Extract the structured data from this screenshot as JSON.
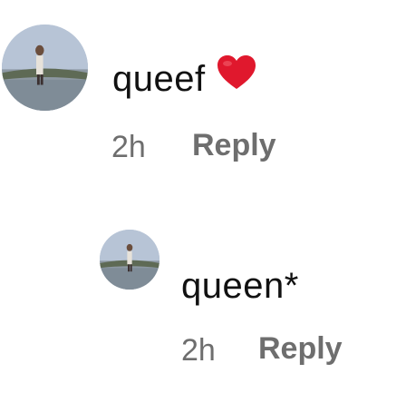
{
  "comments": [
    {
      "text": "queef",
      "emoji": "red-heart",
      "time": "2h",
      "reply_label": "Reply"
    },
    {
      "text": "queen*",
      "time": "2h",
      "reply_label": "Reply"
    }
  ],
  "colors": {
    "text": "#111111",
    "meta": "#6e6e6e",
    "heart": "#e0182d",
    "background": "#ffffff"
  }
}
